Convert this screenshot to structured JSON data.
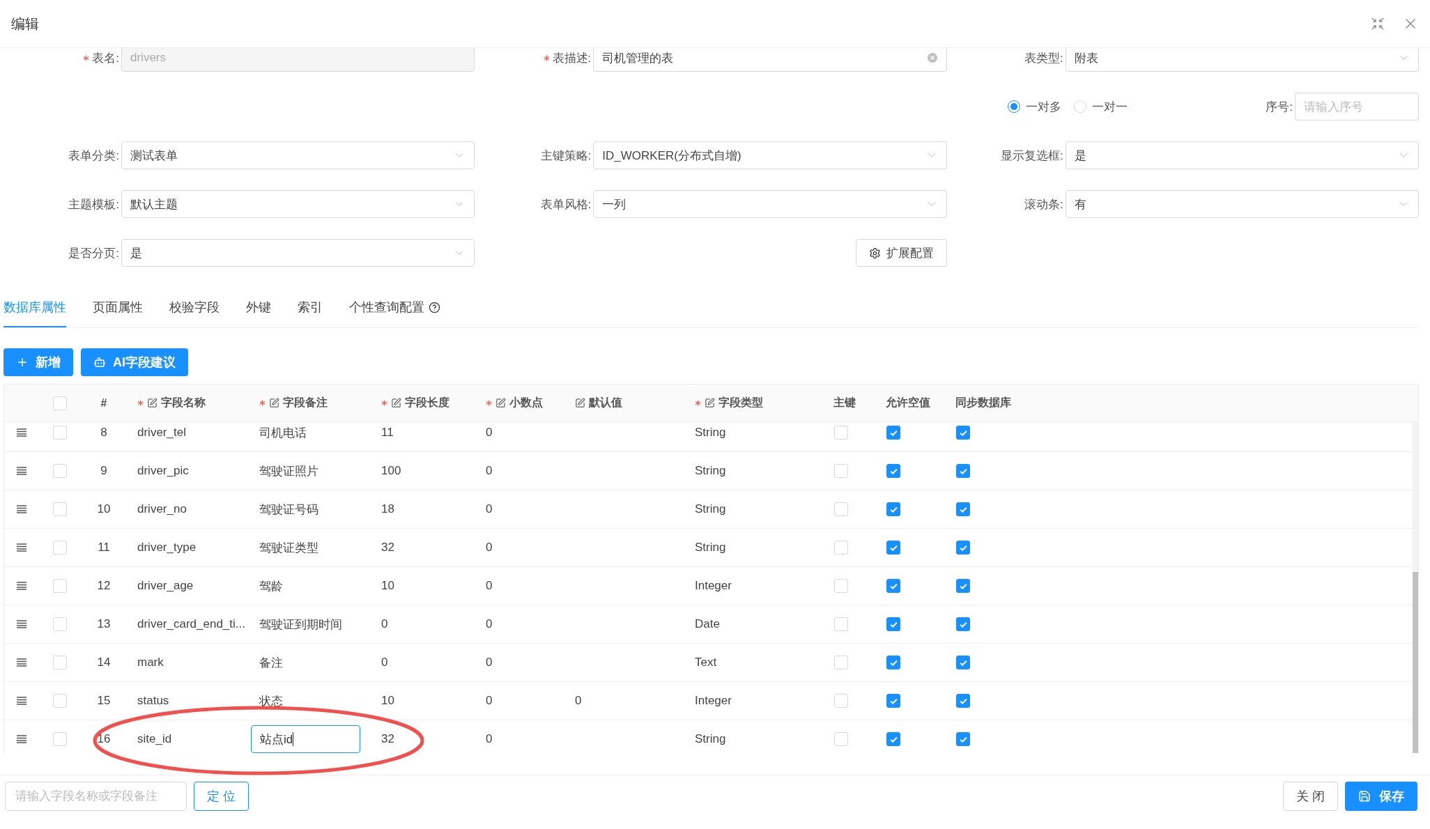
{
  "dialog": {
    "title": "编辑"
  },
  "form": {
    "rows": [
      {
        "kind": "fields",
        "fields": [
          {
            "kind": "input",
            "label": "表名:",
            "required": true,
            "disabled": true,
            "value": "drivers"
          },
          {
            "kind": "input",
            "label": "表描述:",
            "required": true,
            "clearable": true,
            "value": "司机管理的表"
          },
          {
            "kind": "select",
            "label": "表类型:",
            "value": "附表"
          }
        ]
      },
      {
        "kind": "options",
        "radios": [
          {
            "label": "一对多",
            "selected": true
          },
          {
            "label": "一对一",
            "selected": false
          }
        ],
        "sequence": {
          "label": "序号:",
          "placeholder": "请输入序号"
        }
      },
      {
        "kind": "fields",
        "fields": [
          {
            "kind": "select",
            "label": "表单分类:",
            "value": "测试表单"
          },
          {
            "kind": "select",
            "label": "主键策略:",
            "value": "ID_WORKER(分布式自增)"
          },
          {
            "kind": "select",
            "label": "显示复选框:",
            "value": "是"
          }
        ]
      },
      {
        "kind": "fields",
        "fields": [
          {
            "kind": "select",
            "label": "主题模板:",
            "value": "默认主题"
          },
          {
            "kind": "select",
            "label": "表单风格:",
            "value": "一列"
          },
          {
            "kind": "select",
            "label": "滚动条:",
            "value": "有"
          }
        ]
      },
      {
        "kind": "fields",
        "fields": [
          {
            "kind": "select",
            "label": "是否分页:",
            "value": "是"
          },
          {
            "kind": "button",
            "label": "扩展配置"
          }
        ]
      }
    ]
  },
  "tabs": [
    {
      "label": "数据库属性",
      "selected": true
    },
    {
      "label": "页面属性",
      "selected": false
    },
    {
      "label": "校验字段",
      "selected": false
    },
    {
      "label": "外键",
      "selected": false
    },
    {
      "label": "索引",
      "selected": false
    },
    {
      "label": "个性查询配置",
      "selected": false,
      "help": true
    }
  ],
  "toolbar": [
    {
      "kind": "add",
      "label": "新增"
    },
    {
      "kind": "ai",
      "label": "AI字段建议"
    }
  ],
  "table": {
    "select_all": {
      "checked": false
    },
    "columns": [
      {
        "label": "#"
      },
      {
        "label": "字段名称",
        "required": true,
        "editable": true
      },
      {
        "label": "字段备注",
        "required": true,
        "editable": true
      },
      {
        "label": "字段长度",
        "required": true,
        "editable": true
      },
      {
        "label": "小数点",
        "required": true,
        "editable": true
      },
      {
        "label": "默认值",
        "editable": true
      },
      {
        "label": "字段类型",
        "required": true,
        "editable": true
      },
      {
        "label": "主键"
      },
      {
        "label": "允许空值"
      },
      {
        "label": "同步数据库"
      }
    ],
    "rows": [
      {
        "selected": false,
        "no": "8",
        "name": "driver_tel",
        "comment": "司机电话",
        "editing": false,
        "length": "11",
        "decimal": "0",
        "type": "String",
        "primary": false,
        "nullable": true,
        "sync": true
      },
      {
        "selected": false,
        "no": "9",
        "name": "driver_pic",
        "comment": "驾驶证照片",
        "editing": false,
        "length": "100",
        "decimal": "0",
        "type": "String",
        "primary": false,
        "nullable": true,
        "sync": true
      },
      {
        "selected": false,
        "no": "10",
        "name": "driver_no",
        "comment": "驾驶证号码",
        "editing": false,
        "length": "18",
        "decimal": "0",
        "type": "String",
        "primary": false,
        "nullable": true,
        "sync": true
      },
      {
        "selected": false,
        "no": "11",
        "name": "driver_type",
        "comment": "驾驶证类型",
        "editing": false,
        "length": "32",
        "decimal": "0",
        "type": "String",
        "primary": false,
        "nullable": true,
        "sync": true
      },
      {
        "selected": false,
        "no": "12",
        "name": "driver_age",
        "comment": "驾龄",
        "editing": false,
        "length": "10",
        "decimal": "0",
        "type": "Integer",
        "primary": false,
        "nullable": true,
        "sync": true
      },
      {
        "selected": false,
        "no": "13",
        "name": "driver_card_end_ti...",
        "comment": "驾驶证到期时间",
        "editing": false,
        "length": "0",
        "decimal": "0",
        "type": "Date",
        "primary": false,
        "nullable": true,
        "sync": true
      },
      {
        "selected": false,
        "no": "14",
        "name": "mark",
        "comment": "备注",
        "editing": false,
        "length": "0",
        "decimal": "0",
        "type": "Text",
        "primary": false,
        "nullable": true,
        "sync": true
      },
      {
        "selected": false,
        "no": "15",
        "name": "status",
        "comment": "状态",
        "editing": false,
        "length": "10",
        "decimal": "0",
        "default": "0",
        "type": "Integer",
        "primary": false,
        "nullable": true,
        "sync": true
      },
      {
        "selected": false,
        "no": "16",
        "name": "site_id",
        "comment": "站点id",
        "editing": true,
        "length": "32",
        "decimal": "0",
        "type": "String",
        "primary": false,
        "nullable": true,
        "sync": true
      }
    ]
  },
  "highlight": {
    "kind": "ellipse"
  },
  "footer": {
    "search": {
      "placeholder": "请输入字段名称或字段备注"
    },
    "locate": "定 位",
    "close": "关 闭",
    "save": "保存"
  }
}
